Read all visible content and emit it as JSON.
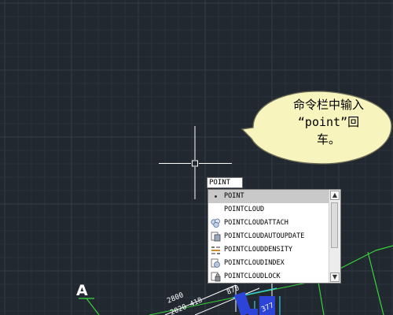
{
  "command_line": {
    "typed_value": "POINT"
  },
  "autocomplete": {
    "items": [
      {
        "label": "POINT",
        "icon": "point-dot-icon",
        "selected": true
      },
      {
        "label": "POINTCLOUD",
        "icon": "",
        "selected": false
      },
      {
        "label": "POINTCLOUDATTACH",
        "icon": "point-cloud-attach-icon",
        "selected": false
      },
      {
        "label": "POINTCLOUDAUTOUPDATE",
        "icon": "point-cloud-autoupdate-icon",
        "selected": false
      },
      {
        "label": "POINTCLOUDDENSITY",
        "icon": "point-cloud-density-icon",
        "selected": false
      },
      {
        "label": "POINTCLOUDINDEX",
        "icon": "point-cloud-index-icon",
        "selected": false
      },
      {
        "label": "POINTCLOUDLOCK",
        "icon": "point-cloud-lock-icon",
        "selected": false
      }
    ],
    "scroll_up_glyph": "▲",
    "scroll_down_glyph": "▼"
  },
  "callout": {
    "line1": "命令栏中输入",
    "line2": "“point”回",
    "line3": "车。"
  },
  "drawing": {
    "label_a": "A",
    "dim_1": "2800",
    "dim_2": "2020 418",
    "dim_3": "870",
    "dim_4": "377"
  },
  "colors": {
    "background": "#212830",
    "grid_minor": "#2a323c",
    "grid_major": "#343d48",
    "crosshair": "#ffffff",
    "callout_fill": "#f7f4be",
    "callout_stroke": "#6b6b55",
    "drawing_green": "#38d438",
    "drawing_blue": "#2c44d8",
    "drawing_cyan": "#39c8e8"
  }
}
